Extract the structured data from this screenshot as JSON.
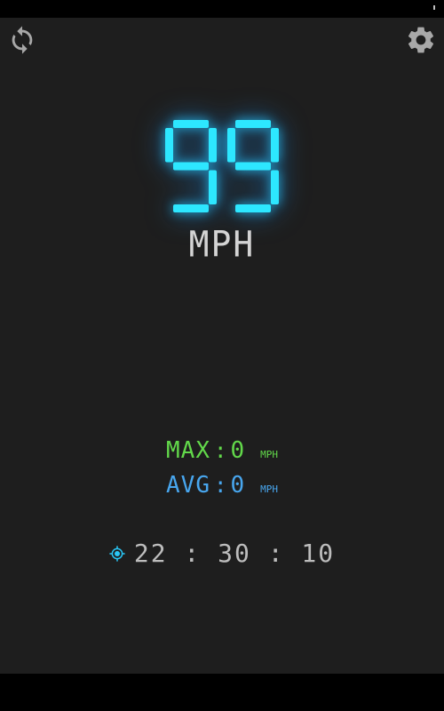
{
  "status_bar": {},
  "toolbar": {
    "refresh_icon": "refresh-icon",
    "settings_icon": "gear-icon"
  },
  "speed": {
    "value": "99",
    "unit": "MPH",
    "color": "#2de7ff"
  },
  "stats": {
    "max": {
      "label": "MAX",
      "separator": ":",
      "value": "0",
      "unit": "MPH",
      "color": "#62d84a"
    },
    "avg": {
      "label": "AVG",
      "separator": ":",
      "value": "0",
      "unit": "MPH",
      "color": "#48a6ee"
    }
  },
  "clock": {
    "gps_icon": "gps-crosshair-icon",
    "time": "22 : 30 : 10",
    "gps_color": "#29c6f5"
  }
}
